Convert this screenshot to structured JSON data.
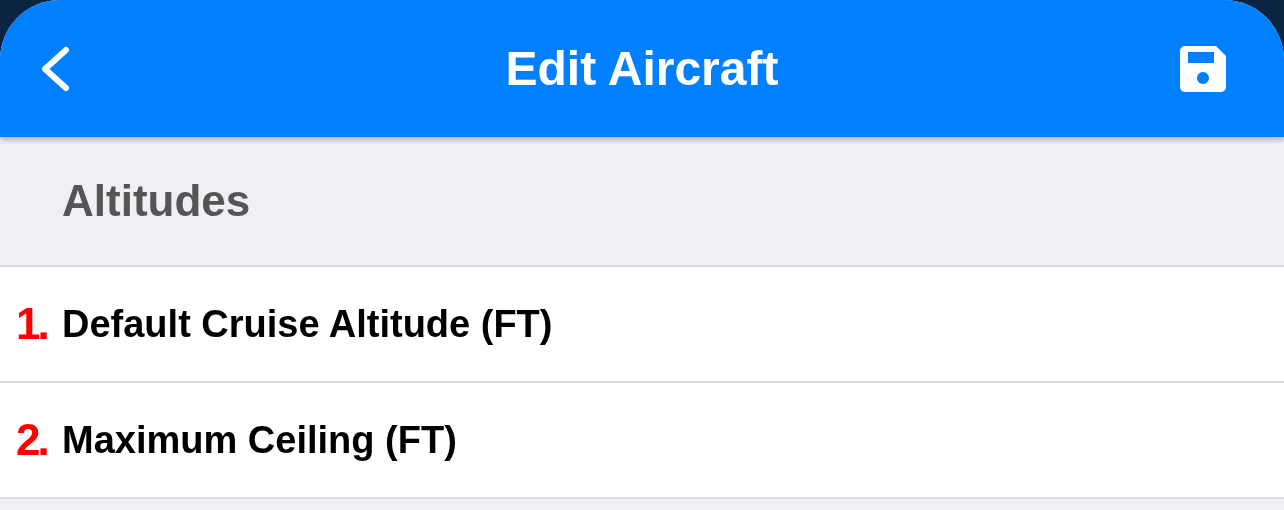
{
  "header": {
    "title": "Edit Aircraft"
  },
  "section": {
    "title": "Altitudes"
  },
  "rows": [
    {
      "marker": "1.",
      "label": "Default Cruise Altitude (FT)"
    },
    {
      "marker": "2.",
      "label": "Maximum Ceiling (FT)"
    }
  ]
}
